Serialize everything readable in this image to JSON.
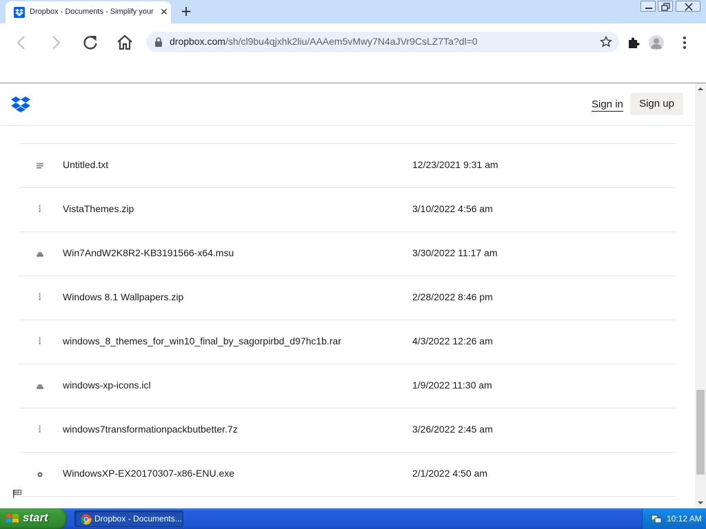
{
  "browser": {
    "tab_title": "Dropbox - Documents - Simplify your",
    "url_host": "dropbox.com",
    "url_path": "/sh/cl9bu4qjxhk2liu/AAAem5vMwy7N4aJVr9CsLZ7Ta?dl=0"
  },
  "header": {
    "signin_label": "Sign in",
    "signup_label": "Sign up"
  },
  "files": [
    {
      "name": "",
      "date": "",
      "icon": "file-icon"
    },
    {
      "name": "Untitled.txt",
      "date": "12/23/2021 9:31 am",
      "icon": "text-file-icon"
    },
    {
      "name": "VistaThemes.zip",
      "date": "3/10/2022 4:56 am",
      "icon": "zip-file-icon"
    },
    {
      "name": "Win7AndW2K8R2-KB3191566-x64.msu",
      "date": "3/30/2022 11:17 am",
      "icon": "package-file-icon"
    },
    {
      "name": "Windows 8.1 Wallpapers.zip",
      "date": "2/28/2022 8:46 pm",
      "icon": "zip-file-icon"
    },
    {
      "name": "windows_8_themes_for_win10_final_by_sagorpirbd_d97hc1b.rar",
      "date": "4/3/2022 12:26 am",
      "icon": "zip-file-icon"
    },
    {
      "name": "windows-xp-icons.icl",
      "date": "1/9/2022 11:30 am",
      "icon": "package-file-icon"
    },
    {
      "name": "windows7transformationpackbutbetter.7z",
      "date": "3/26/2022 2:45 am",
      "icon": "zip-file-icon"
    },
    {
      "name": "WindowsXP-EX20170307-x86-ENU.exe",
      "date": "2/1/2022 4:50 am",
      "icon": "executable-file-icon"
    }
  ],
  "taskbar": {
    "start_label": "start",
    "window_label": "Dropbox - Documents...",
    "clock": "10:12 AM"
  }
}
